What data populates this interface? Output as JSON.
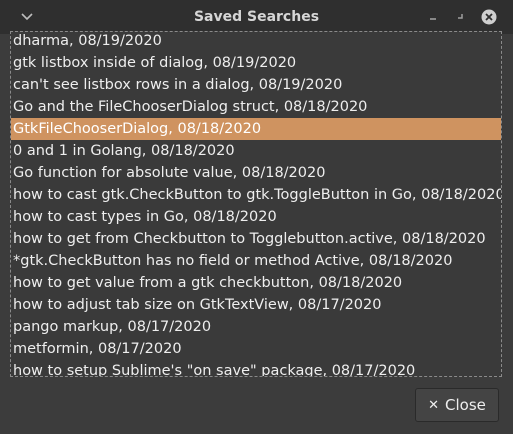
{
  "window": {
    "title": "Saved Searches",
    "icons": [
      "chevron-down-icon",
      "minimize-icon",
      "restore-icon",
      "close-circle-icon"
    ]
  },
  "colors": {
    "selection": "#cf9360",
    "background": "#3c3c3c",
    "titlebar": "#2f2f2f"
  },
  "list": {
    "selected_index": 4,
    "items": [
      {
        "label": "dharma, 08/19/2020"
      },
      {
        "label": "gtk listbox inside of dialog, 08/19/2020"
      },
      {
        "label": "can't see listbox rows in a dialog, 08/19/2020"
      },
      {
        "label": "Go and the FileChooserDialog struct, 08/18/2020"
      },
      {
        "label": "GtkFileChooserDialog, 08/18/2020"
      },
      {
        "label": "0 and 1 in Golang, 08/18/2020"
      },
      {
        "label": "Go function for absolute value, 08/18/2020"
      },
      {
        "label": "how to cast gtk.CheckButton to gtk.ToggleButton in Go, 08/18/2020"
      },
      {
        "label": "how to cast types in Go, 08/18/2020"
      },
      {
        "label": "how to get from Checkbutton to Togglebutton.active, 08/18/2020"
      },
      {
        "label": "*gtk.CheckButton has no field or method Active, 08/18/2020"
      },
      {
        "label": "how to get value from a gtk checkbutton, 08/18/2020"
      },
      {
        "label": "how to adjust tab size on GtkTextView, 08/17/2020"
      },
      {
        "label": "pango markup, 08/17/2020"
      },
      {
        "label": "metformin, 08/17/2020"
      },
      {
        "label": "how to setup Sublime's \"on save\" package, 08/17/2020"
      }
    ]
  },
  "footer": {
    "close_label": "Close"
  }
}
